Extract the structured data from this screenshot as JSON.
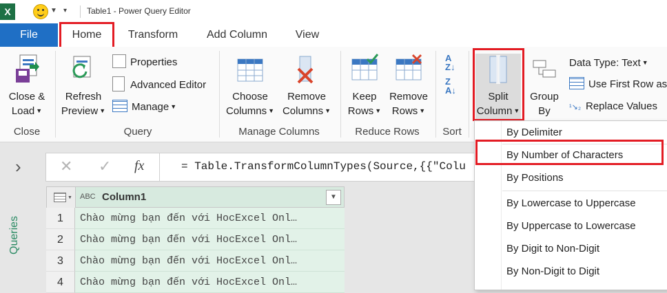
{
  "titlebar": {
    "excel_logo": "X",
    "title": "Table1 - Power Query Editor"
  },
  "tabs": [
    {
      "label": "File"
    },
    {
      "label": "Home"
    },
    {
      "label": "Transform"
    },
    {
      "label": "Add Column"
    },
    {
      "label": "View"
    }
  ],
  "ribbon": {
    "close_group": {
      "button_line1": "Close &",
      "button_line2": "Load",
      "label": "Close"
    },
    "query_group": {
      "refresh_line1": "Refresh",
      "refresh_line2": "Preview",
      "properties": "Properties",
      "advanced_editor": "Advanced Editor",
      "manage": "Manage",
      "label": "Query"
    },
    "manage_columns_group": {
      "choose_line1": "Choose",
      "choose_line2": "Columns",
      "remove_line1": "Remove",
      "remove_line2": "Columns",
      "label": "Manage Columns"
    },
    "reduce_rows_group": {
      "keep_line1": "Keep",
      "keep_line2": "Rows",
      "remove_line1": "Remove",
      "remove_line2": "Rows",
      "label": "Reduce Rows"
    },
    "sort_group": {
      "label": "Sort"
    },
    "transform_group": {
      "split_line1": "Split",
      "split_line2": "Column",
      "group_line1": "Group",
      "group_line2": "By",
      "data_type": "Data Type: Text",
      "first_row": "Use First Row as",
      "replace_values": "Replace Values"
    }
  },
  "formula_bar": {
    "fx": "fx",
    "text": "= Table.TransformColumnTypes(Source,{{\"Colu"
  },
  "side_panel": {
    "label": "Queries",
    "expand_glyph": "›"
  },
  "grid": {
    "column_type": "ABC",
    "column_header": "Column1",
    "rows": [
      {
        "num": "1",
        "value": "Chào mừng bạn đến với HocExcel Onl…"
      },
      {
        "num": "2",
        "value": "Chào mừng bạn đến với HocExcel Onl…"
      },
      {
        "num": "3",
        "value": "Chào mừng bạn đến với HocExcel Onl…"
      },
      {
        "num": "4",
        "value": "Chào mừng bạn đến với HocExcel Onl…"
      }
    ]
  },
  "split_menu": {
    "items": [
      {
        "label": "By Delimiter"
      },
      {
        "label": "By Number of Characters"
      },
      {
        "label": "By Positions"
      },
      {
        "label": "By Lowercase to Uppercase"
      },
      {
        "label": "By Uppercase to Lowercase"
      },
      {
        "label": "By Digit to Non-Digit"
      },
      {
        "label": "By Non-Digit to Digit"
      }
    ]
  },
  "colors": {
    "accent": "#1f6fc5",
    "highlight_box": "#e31b23",
    "query_green": "#2a8a63",
    "grid_fill": "#e2f2e8"
  }
}
